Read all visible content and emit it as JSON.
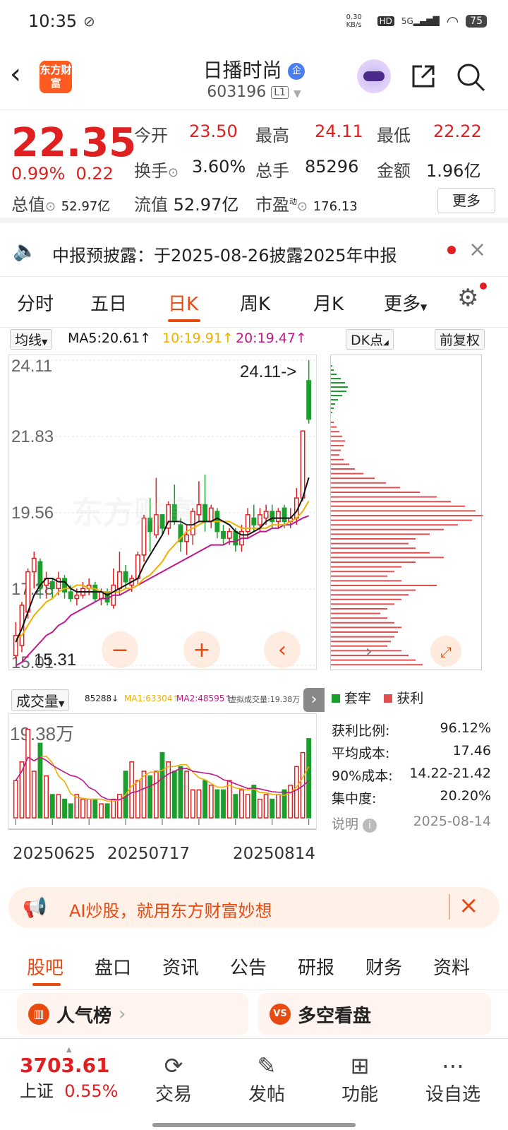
{
  "status_bar": {
    "time": "10:35",
    "net_speed": "0.30 KB/s",
    "signal": "5G",
    "hd": "HD",
    "battery": "75"
  },
  "header": {
    "logo_text": "东方财富",
    "title": "日播时尚",
    "title_badge": "企",
    "code": "603196",
    "level": "L1"
  },
  "quote": {
    "price": "22.35",
    "change_pct": "0.99%",
    "change": "0.22",
    "open_label": "今开",
    "open": "23.50",
    "high_label": "最高",
    "high": "24.11",
    "low_label": "最低",
    "low": "22.22",
    "turnover_label": "换手",
    "turnover": "3.60%",
    "volume_label": "总手",
    "volume": "85296",
    "amount_label": "金额",
    "amount": "1.96亿",
    "mktcap_label": "总值",
    "mktcap": "52.97亿",
    "float_label": "流值",
    "float_cap": "52.97亿",
    "pe_label": "市盈",
    "pe_sup": "动",
    "pe": "176.13",
    "more": "更多"
  },
  "notice": {
    "text": "中报预披露：于2025-08-26披露2025年中报"
  },
  "tabs": [
    "分时",
    "五日",
    "日K",
    "周K",
    "月K",
    "更多"
  ],
  "chart_toolbar": {
    "ma_label": "均线",
    "ma5": "MA5:20.61",
    "ma10": "10:19.91",
    "ma20": "20:19.47",
    "dk": "DK点",
    "fq": "前复权"
  },
  "colors": {
    "up": "#e02020",
    "down": "#1a9e2c",
    "ma5": "#111111",
    "ma10": "#f0b000",
    "ma20": "#c0178a",
    "accent": "#e84a10"
  },
  "chart_data": {
    "type": "candlestick",
    "y_ticks": [
      "24.11",
      "21.83",
      "19.56",
      "17.28",
      "15.01"
    ],
    "ylim": [
      15.01,
      24.11
    ],
    "high_marker": "24.11->",
    "low_marker": "15.31",
    "candles": [
      [
        15.3,
        15.9,
        15.2,
        16.3
      ],
      [
        15.6,
        16.8,
        15.4,
        16.9
      ],
      [
        16.6,
        17.8,
        16.4,
        17.9
      ],
      [
        17.8,
        18.2,
        17.3,
        18.4
      ],
      [
        18.1,
        17.3,
        17.0,
        18.2
      ],
      [
        17.4,
        17.6,
        17.0,
        17.8
      ],
      [
        17.5,
        17.3,
        17.0,
        17.6
      ],
      [
        17.3,
        17.6,
        17.1,
        17.8
      ],
      [
        17.6,
        17.2,
        17.0,
        17.7
      ],
      [
        17.2,
        17.0,
        16.9,
        17.4
      ],
      [
        17.0,
        17.1,
        16.8,
        17.3
      ],
      [
        17.1,
        17.3,
        17.0,
        17.5
      ],
      [
        17.3,
        17.4,
        17.1,
        17.6
      ],
      [
        17.4,
        17.0,
        16.9,
        17.5
      ],
      [
        17.0,
        17.2,
        16.8,
        17.3
      ],
      [
        17.2,
        16.9,
        16.8,
        17.3
      ],
      [
        16.8,
        17.4,
        16.7,
        17.9
      ],
      [
        17.3,
        17.8,
        17.1,
        18.4
      ],
      [
        17.8,
        17.5,
        17.3,
        18.0
      ],
      [
        17.4,
        17.6,
        17.2,
        17.7
      ],
      [
        17.6,
        18.3,
        17.4,
        18.4
      ],
      [
        18.3,
        19.4,
        18.1,
        19.5
      ],
      [
        19.4,
        19.0,
        18.4,
        20.0
      ],
      [
        18.9,
        19.5,
        18.8,
        20.6
      ],
      [
        19.5,
        19.1,
        18.9,
        19.5
      ],
      [
        19.1,
        19.8,
        18.9,
        19.9
      ],
      [
        19.8,
        19.3,
        19.2,
        20.4
      ],
      [
        19.2,
        18.7,
        18.4,
        19.4
      ],
      [
        18.7,
        18.9,
        18.3,
        19.2
      ],
      [
        18.9,
        19.6,
        18.6,
        19.7
      ],
      [
        19.5,
        19.8,
        19.3,
        20.5
      ],
      [
        19.8,
        19.3,
        19.0,
        20.7
      ],
      [
        19.3,
        19.7,
        19.1,
        19.8
      ],
      [
        19.6,
        19.0,
        18.8,
        19.7
      ],
      [
        19.0,
        18.8,
        18.6,
        19.2
      ],
      [
        18.8,
        19.0,
        18.6,
        19.1
      ],
      [
        19.0,
        18.6,
        18.4,
        19.1
      ],
      [
        18.6,
        19.0,
        18.4,
        19.2
      ],
      [
        19.0,
        19.5,
        18.8,
        19.7
      ],
      [
        19.4,
        19.2,
        19.0,
        19.8
      ],
      [
        19.2,
        19.5,
        19.0,
        19.7
      ],
      [
        19.4,
        19.6,
        19.2,
        19.8
      ],
      [
        19.6,
        19.3,
        19.1,
        19.8
      ],
      [
        19.3,
        19.6,
        19.1,
        19.7
      ],
      [
        19.7,
        19.3,
        19.1,
        19.8
      ],
      [
        19.3,
        19.4,
        19.1,
        19.7
      ],
      [
        19.4,
        20.0,
        19.2,
        20.3
      ],
      [
        20.0,
        22.0,
        19.9,
        22.0
      ],
      [
        23.5,
        22.35,
        22.22,
        24.11
      ]
    ],
    "ma5": [
      15.7,
      16.1,
      16.6,
      17.1,
      17.4,
      17.6,
      17.6,
      17.5,
      17.5,
      17.3,
      17.2,
      17.2,
      17.2,
      17.2,
      17.2,
      17.1,
      17.2,
      17.3,
      17.4,
      17.5,
      17.6,
      18.0,
      18.3,
      18.6,
      18.9,
      19.3,
      19.3,
      19.3,
      19.2,
      19.2,
      19.3,
      19.3,
      19.3,
      19.4,
      19.3,
      19.2,
      19.0,
      18.9,
      18.9,
      19.0,
      19.1,
      19.3,
      19.4,
      19.4,
      19.4,
      19.4,
      19.6,
      20.0,
      20.61
    ],
    "ma10": [
      15.8,
      15.9,
      16.2,
      16.5,
      16.7,
      16.9,
      17.0,
      17.2,
      17.3,
      17.3,
      17.4,
      17.4,
      17.3,
      17.3,
      17.2,
      17.2,
      17.2,
      17.2,
      17.3,
      17.3,
      17.4,
      17.6,
      17.7,
      17.9,
      18.1,
      18.4,
      18.6,
      18.8,
      19.0,
      19.1,
      19.2,
      19.3,
      19.3,
      19.3,
      19.3,
      19.3,
      19.2,
      19.1,
      19.1,
      19.1,
      19.1,
      19.1,
      19.2,
      19.2,
      19.2,
      19.3,
      19.4,
      19.6,
      19.91
    ],
    "ma20": [
      15.0,
      15.1,
      15.3,
      15.5,
      15.7,
      15.9,
      16.0,
      16.2,
      16.3,
      16.5,
      16.6,
      16.7,
      16.8,
      16.9,
      17.0,
      17.0,
      17.1,
      17.1,
      17.2,
      17.3,
      17.4,
      17.5,
      17.6,
      17.7,
      17.8,
      17.9,
      18.0,
      18.1,
      18.2,
      18.3,
      18.4,
      18.5,
      18.6,
      18.6,
      18.6,
      18.7,
      18.7,
      18.8,
      18.8,
      18.9,
      19.0,
      19.0,
      19.1,
      19.1,
      19.2,
      19.2,
      19.3,
      19.4,
      19.47
    ],
    "volume_label": "成交量",
    "volume_values_label": "85288↓",
    "vol_ma1": "MA1:63304↑",
    "vol_ma2": "MA2:48595↑",
    "virtual_vol": "虚拟成交量:19.38万",
    "volume_max_label": "19.38万",
    "volumes": [
      8,
      12,
      19,
      10,
      16,
      9,
      5,
      5,
      4,
      3,
      5,
      4,
      4,
      4,
      3,
      3,
      4,
      5,
      10,
      12,
      8,
      10,
      9,
      10,
      14,
      12,
      10,
      11,
      10,
      6,
      6,
      8,
      7,
      6,
      6,
      8,
      5,
      6,
      5,
      7,
      4,
      5,
      4,
      5,
      6,
      7,
      11,
      14,
      17
    ],
    "dates": [
      "20250625",
      "20250717",
      "20250814"
    ],
    "chip_profile": {
      "green": [
        2,
        4,
        8,
        14,
        20,
        24,
        22,
        16,
        10,
        6,
        4,
        2
      ],
      "red": [
        4,
        8,
        12,
        16,
        20,
        18,
        14,
        12,
        18,
        26,
        34,
        46,
        62,
        78,
        98,
        126,
        150,
        170,
        190,
        205,
        215,
        200,
        180,
        160,
        140,
        120,
        110,
        120,
        140,
        160,
        120,
        100,
        90,
        80,
        100,
        150,
        120,
        110,
        100,
        90,
        80,
        70,
        80,
        90,
        100,
        95,
        90,
        85,
        80,
        100,
        110,
        120,
        130
      ]
    }
  },
  "chip_stats": {
    "legend_green": "套牢",
    "legend_red": "获利",
    "profit_ratio_label": "获利比例:",
    "profit_ratio": "96.12%",
    "avg_cost_label": "平均成本:",
    "avg_cost": "17.46",
    "cost90_label": "90%成本:",
    "cost90": "14.22-21.42",
    "concentration_label": "集中度:",
    "concentration": "20.20%",
    "explain_label": "说明",
    "date": "2025-08-14"
  },
  "ai_banner": {
    "text": "AI炒股，就用东方财富妙想"
  },
  "bottom_tabs": [
    "股吧",
    "盘口",
    "资讯",
    "公告",
    "研报",
    "财务",
    "资料"
  ],
  "cards": {
    "left": "人气榜",
    "right": "多空看盘"
  },
  "bottom_nav": {
    "index_value": "3703.61",
    "index_name": "上证",
    "index_change": "0.55%",
    "items": [
      "交易",
      "发帖",
      "功能",
      "设自选"
    ]
  }
}
